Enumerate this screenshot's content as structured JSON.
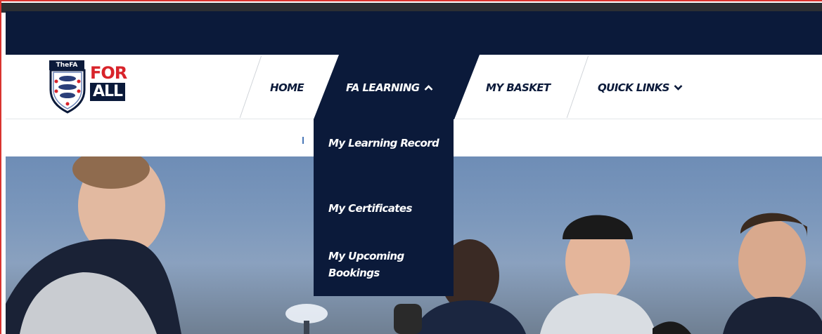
{
  "logo": {
    "fa_tag": "TheFA",
    "for": "FOR",
    "all": "ALL"
  },
  "nav": {
    "home": "HOME",
    "fa_learning": "FA LEARNING",
    "my_basket": "MY BASKET",
    "quick_links": "QUICK LINKS"
  },
  "icons": {
    "fa_learning": "chevron-up-icon",
    "quick_links": "chevron-down-icon"
  },
  "dropdown": {
    "items": [
      "My Learning Record",
      "My Certificates",
      "My Upcoming Bookings"
    ]
  },
  "colors": {
    "navy": "#0b1a3a",
    "brand_red": "#d8232a",
    "frame_red": "#d9342f"
  }
}
